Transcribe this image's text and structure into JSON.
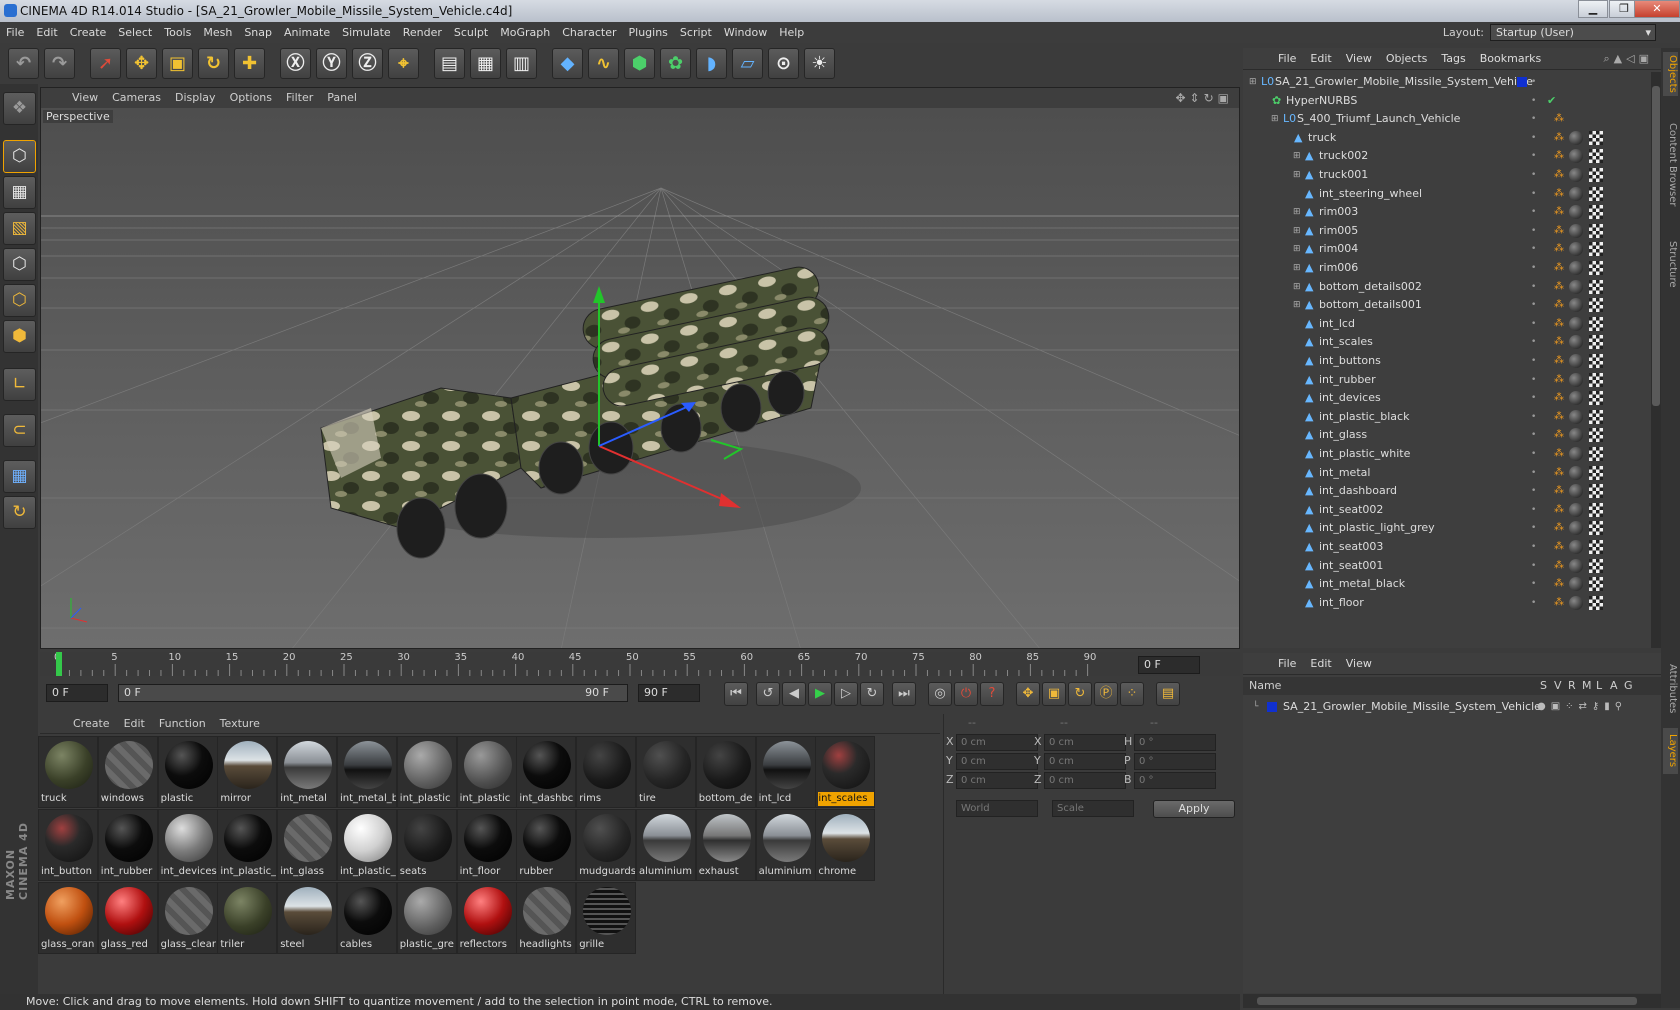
{
  "window": {
    "title": "CINEMA 4D R14.014 Studio - [SA_21_Growler_Mobile_Missile_System_Vehicle.c4d]",
    "minimize": "▁",
    "maximize": "❐",
    "close": "✕"
  },
  "menubar": [
    "File",
    "Edit",
    "Create",
    "Select",
    "Tools",
    "Mesh",
    "Snap",
    "Animate",
    "Simulate",
    "Render",
    "Sculpt",
    "MoGraph",
    "Character",
    "Plugins",
    "Script",
    "Window",
    "Help"
  ],
  "layout": {
    "label": "Layout:",
    "value": "Startup (User)"
  },
  "viewport": {
    "menu": [
      "View",
      "Cameras",
      "Display",
      "Options",
      "Filter",
      "Panel"
    ],
    "label": "Perspective"
  },
  "timeline": {
    "ticks": [
      "0",
      "5",
      "10",
      "15",
      "20",
      "25",
      "30",
      "35",
      "40",
      "45",
      "50",
      "55",
      "60",
      "65",
      "70",
      "75",
      "80",
      "85",
      "90"
    ],
    "current": "0 F"
  },
  "transport": {
    "start": "0 F",
    "range_start": "0 F",
    "range_end": "90 F",
    "end": "90 F"
  },
  "materials": {
    "menu": [
      "Create",
      "Edit",
      "Function",
      "Texture"
    ],
    "items": [
      {
        "label": "truck",
        "style": "camo"
      },
      {
        "label": "windows",
        "style": "glass"
      },
      {
        "label": "plastic",
        "style": "black"
      },
      {
        "label": "mirror",
        "style": "mirror"
      },
      {
        "label": "int_metal",
        "style": "chrome"
      },
      {
        "label": "int_metal_b",
        "style": "darkchrome"
      },
      {
        "label": "int_plastic",
        "style": "gray"
      },
      {
        "label": "int_plastic",
        "style": "gray2"
      },
      {
        "label": "int_dashbc",
        "style": "black"
      },
      {
        "label": "rims",
        "style": "dark"
      },
      {
        "label": "tire",
        "style": "dark2"
      },
      {
        "label": "bottom_de",
        "style": "dark"
      },
      {
        "label": "int_lcd",
        "style": "darkchrome"
      },
      {
        "label": "int_scales",
        "style": "lcd",
        "selected": true
      },
      {
        "label": "int_button",
        "style": "lcd"
      },
      {
        "label": "int_rubber",
        "style": "black"
      },
      {
        "label": "int_devices",
        "style": "gray3"
      },
      {
        "label": "int_plastic_",
        "style": "black"
      },
      {
        "label": "int_glass",
        "style": "glass"
      },
      {
        "label": "int_plastic_",
        "style": "white"
      },
      {
        "label": "seats",
        "style": "dark"
      },
      {
        "label": "int_floor",
        "style": "black"
      },
      {
        "label": "rubber",
        "style": "black"
      },
      {
        "label": "mudguards",
        "style": "dark2"
      },
      {
        "label": "aluminium",
        "style": "chrome"
      },
      {
        "label": "exhaust",
        "style": "chrome2"
      },
      {
        "label": "aluminium",
        "style": "chrome"
      },
      {
        "label": "chrome",
        "style": "mirror"
      },
      {
        "label": "glass_oran",
        "style": "orange"
      },
      {
        "label": "glass_red",
        "style": "red"
      },
      {
        "label": "glass_clear",
        "style": "glass"
      },
      {
        "label": "triler",
        "style": "camo"
      },
      {
        "label": "steel",
        "style": "mirror"
      },
      {
        "label": "cables",
        "style": "black"
      },
      {
        "label": "plastic_gre",
        "style": "gray"
      },
      {
        "label": "reflectors",
        "style": "red"
      },
      {
        "label": "headlights",
        "style": "glass"
      },
      {
        "label": "grille",
        "style": "grille"
      }
    ]
  },
  "coords": {
    "header": [
      "--",
      "--",
      "--"
    ],
    "rows": [
      {
        "a": "X",
        "av": "0 cm",
        "b": "X",
        "bv": "0 cm",
        "c": "H",
        "cv": "0 °"
      },
      {
        "a": "Y",
        "av": "0 cm",
        "b": "Y",
        "bv": "0 cm",
        "c": "P",
        "cv": "0 °"
      },
      {
        "a": "Z",
        "av": "0 cm",
        "b": "Z",
        "bv": "0 cm",
        "c": "B",
        "cv": "0 °"
      }
    ],
    "mode": "World",
    "scale": "Scale",
    "apply": "Apply"
  },
  "objects": {
    "menu": [
      "File",
      "Edit",
      "View",
      "Objects",
      "Tags",
      "Bookmarks"
    ],
    "rows": [
      {
        "name": "SA_21_Growler_Mobile_Missile_System_Vehicle",
        "level": 0,
        "icon": "L0"
      },
      {
        "name": "HyperNURBS",
        "level": 1,
        "icon": "✿"
      },
      {
        "name": "S_400_Triumf_Launch_Vehicle",
        "level": 2,
        "icon": "L0"
      },
      {
        "name": "truck",
        "level": 3,
        "icon": "▲"
      },
      {
        "name": "truck002",
        "level": 4,
        "icon": "▲"
      },
      {
        "name": "truck001",
        "level": 4,
        "icon": "▲"
      },
      {
        "name": "int_steering_wheel",
        "level": 4,
        "icon": "▲"
      },
      {
        "name": "rim003",
        "level": 4,
        "icon": "▲"
      },
      {
        "name": "rim005",
        "level": 4,
        "icon": "▲"
      },
      {
        "name": "rim004",
        "level": 4,
        "icon": "▲"
      },
      {
        "name": "rim006",
        "level": 4,
        "icon": "▲"
      },
      {
        "name": "bottom_details002",
        "level": 4,
        "icon": "▲"
      },
      {
        "name": "bottom_details001",
        "level": 4,
        "icon": "▲"
      },
      {
        "name": "int_lcd",
        "level": 4,
        "icon": "▲"
      },
      {
        "name": "int_scales",
        "level": 4,
        "icon": "▲"
      },
      {
        "name": "int_buttons",
        "level": 4,
        "icon": "▲"
      },
      {
        "name": "int_rubber",
        "level": 4,
        "icon": "▲"
      },
      {
        "name": "int_devices",
        "level": 4,
        "icon": "▲"
      },
      {
        "name": "int_plastic_black",
        "level": 4,
        "icon": "▲"
      },
      {
        "name": "int_glass",
        "level": 4,
        "icon": "▲"
      },
      {
        "name": "int_plastic_white",
        "level": 4,
        "icon": "▲"
      },
      {
        "name": "int_metal",
        "level": 4,
        "icon": "▲"
      },
      {
        "name": "int_dashboard",
        "level": 4,
        "icon": "▲"
      },
      {
        "name": "int_seat002",
        "level": 4,
        "icon": "▲"
      },
      {
        "name": "int_plastic_light_grey",
        "level": 4,
        "icon": "▲"
      },
      {
        "name": "int_seat003",
        "level": 4,
        "icon": "▲"
      },
      {
        "name": "int_seat001",
        "level": 4,
        "icon": "▲"
      },
      {
        "name": "int_metal_black",
        "level": 4,
        "icon": "▲"
      },
      {
        "name": "int_floor",
        "level": 4,
        "icon": "▲"
      }
    ]
  },
  "layers": {
    "menu": [
      "File",
      "Edit",
      "View"
    ],
    "header": {
      "name": "Name",
      "cols": [
        "S",
        "V",
        "R",
        "M",
        "L",
        "A",
        "G"
      ]
    },
    "row": "SA_21_Growler_Mobile_Missile_System_Vehicle"
  },
  "side_tabs": [
    "Objects",
    "Content Browser",
    "Structure",
    "Attributes",
    "Layers"
  ],
  "status": "Move: Click and drag to move elements. Hold down SHIFT to quantize movement / add to the selection in point mode, CTRL to remove.",
  "brand": "MAXON CINEMA 4D"
}
